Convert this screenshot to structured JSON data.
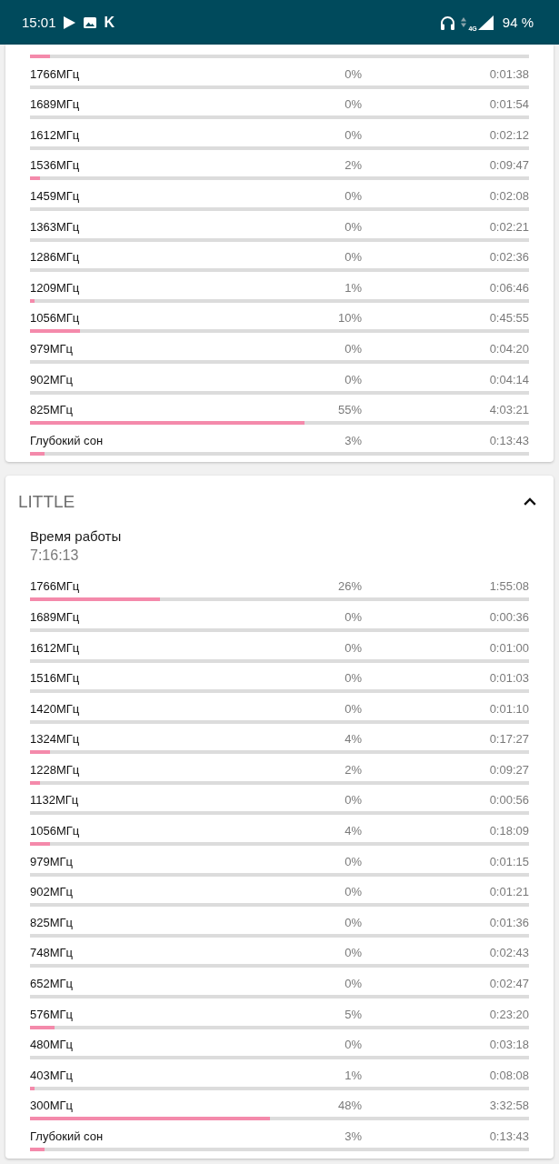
{
  "status_bar": {
    "time": "15:01",
    "notification_letter": "K",
    "network": "4G",
    "battery": "94 %"
  },
  "cards": [
    {
      "rows": [
        {
          "level": 0.04
        },
        {
          "label": "1766МГц",
          "percent": "0%",
          "time": "0:01:38",
          "level": 0
        },
        {
          "label": "1689МГц",
          "percent": "0%",
          "time": "0:01:54",
          "level": 0
        },
        {
          "label": "1612МГц",
          "percent": "0%",
          "time": "0:02:12",
          "level": 0
        },
        {
          "label": "1536МГц",
          "percent": "2%",
          "time": "0:09:47",
          "level": 0.02
        },
        {
          "label": "1459МГц",
          "percent": "0%",
          "time": "0:02:08",
          "level": 0
        },
        {
          "label": "1363МГц",
          "percent": "0%",
          "time": "0:02:21",
          "level": 0
        },
        {
          "label": "1286МГц",
          "percent": "0%",
          "time": "0:02:36",
          "level": 0
        },
        {
          "label": "1209МГц",
          "percent": "1%",
          "time": "0:06:46",
          "level": 0.01
        },
        {
          "label": "1056МГц",
          "percent": "10%",
          "time": "0:45:55",
          "level": 0.1
        },
        {
          "label": "979МГц",
          "percent": "0%",
          "time": "0:04:20",
          "level": 0
        },
        {
          "label": "902МГц",
          "percent": "0%",
          "time": "0:04:14",
          "level": 0
        },
        {
          "label": "825МГц",
          "percent": "55%",
          "time": "4:03:21",
          "level": 0.55
        },
        {
          "label": "Глубокий сон",
          "percent": "3%",
          "time": "0:13:43",
          "level": 0.03
        }
      ]
    },
    {
      "title": "LITTLE",
      "expanded": true,
      "uptime_label": "Время работы",
      "uptime": "7:16:13",
      "rows": [
        {
          "label": "1766МГц",
          "percent": "26%",
          "time": "1:55:08",
          "level": 0.26
        },
        {
          "label": "1689МГц",
          "percent": "0%",
          "time": "0:00:36",
          "level": 0
        },
        {
          "label": "1612МГц",
          "percent": "0%",
          "time": "0:01:00",
          "level": 0
        },
        {
          "label": "1516МГц",
          "percent": "0%",
          "time": "0:01:03",
          "level": 0
        },
        {
          "label": "1420МГц",
          "percent": "0%",
          "time": "0:01:10",
          "level": 0
        },
        {
          "label": "1324МГц",
          "percent": "4%",
          "time": "0:17:27",
          "level": 0.04
        },
        {
          "label": "1228МГц",
          "percent": "2%",
          "time": "0:09:27",
          "level": 0.02
        },
        {
          "label": "1132МГц",
          "percent": "0%",
          "time": "0:00:56",
          "level": 0
        },
        {
          "label": "1056МГц",
          "percent": "4%",
          "time": "0:18:09",
          "level": 0.04
        },
        {
          "label": "979МГц",
          "percent": "0%",
          "time": "0:01:15",
          "level": 0
        },
        {
          "label": "902МГц",
          "percent": "0%",
          "time": "0:01:21",
          "level": 0
        },
        {
          "label": "825МГц",
          "percent": "0%",
          "time": "0:01:36",
          "level": 0
        },
        {
          "label": "748МГц",
          "percent": "0%",
          "time": "0:02:43",
          "level": 0
        },
        {
          "label": "652МГц",
          "percent": "0%",
          "time": "0:02:47",
          "level": 0
        },
        {
          "label": "576МГц",
          "percent": "5%",
          "time": "0:23:20",
          "level": 0.05
        },
        {
          "label": "480МГц",
          "percent": "0%",
          "time": "0:03:18",
          "level": 0
        },
        {
          "label": "403МГц",
          "percent": "1%",
          "time": "0:08:08",
          "level": 0.01
        },
        {
          "label": "300МГц",
          "percent": "48%",
          "time": "3:32:58",
          "level": 0.48
        },
        {
          "label": "Глубокий сон",
          "percent": "3%",
          "time": "0:13:43",
          "level": 0.03
        }
      ]
    }
  ]
}
